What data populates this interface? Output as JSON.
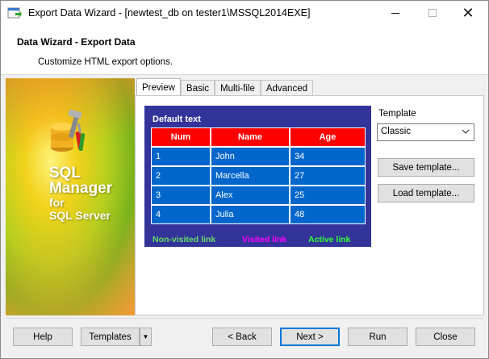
{
  "window": {
    "title": "Export Data Wizard - [newtest_db on tester1\\MSSQL2014EXE]",
    "minimize_icon": "minimize-icon",
    "maximize_icon": "maximize-icon",
    "close_glyph": "✕"
  },
  "header": {
    "title": "Data Wizard - Export Data",
    "subtitle": "Customize HTML export options."
  },
  "banner": {
    "line1": "SQL",
    "line2": "Manager",
    "line3": "for",
    "line4": "SQL Server",
    "logo_icon": "sql-manager-logo-icon"
  },
  "tabs": [
    {
      "label": "Preview",
      "active": true
    },
    {
      "label": "Basic",
      "active": false
    },
    {
      "label": "Multi-file",
      "active": false
    },
    {
      "label": "Advanced",
      "active": false
    }
  ],
  "preview": {
    "title": "Default text",
    "columns": [
      "Num",
      "Name",
      "Age"
    ],
    "rows": [
      [
        "1",
        "John",
        "34"
      ],
      [
        "2",
        "Marcella",
        "27"
      ],
      [
        "3",
        "Alex",
        "25"
      ],
      [
        "4",
        "Julia",
        "48"
      ]
    ],
    "link_nonvisited": "Non-visited link",
    "link_visited": "Visited link",
    "link_active": "Active link",
    "colors": {
      "background": "#333399",
      "header_bg": "#ff0000",
      "cell_bg": "#0066cc",
      "nonvisited": "#66dd66",
      "visited": "#ff00ff",
      "active": "#33ff33"
    }
  },
  "template": {
    "label": "Template",
    "selected": "Classic",
    "save_button": "Save template...",
    "load_button": "Load template..."
  },
  "footer": {
    "help": "Help",
    "templates": "Templates",
    "templates_dropdown_glyph": "▼",
    "back": "< Back",
    "next": "Next >",
    "run": "Run",
    "close": "Close"
  }
}
